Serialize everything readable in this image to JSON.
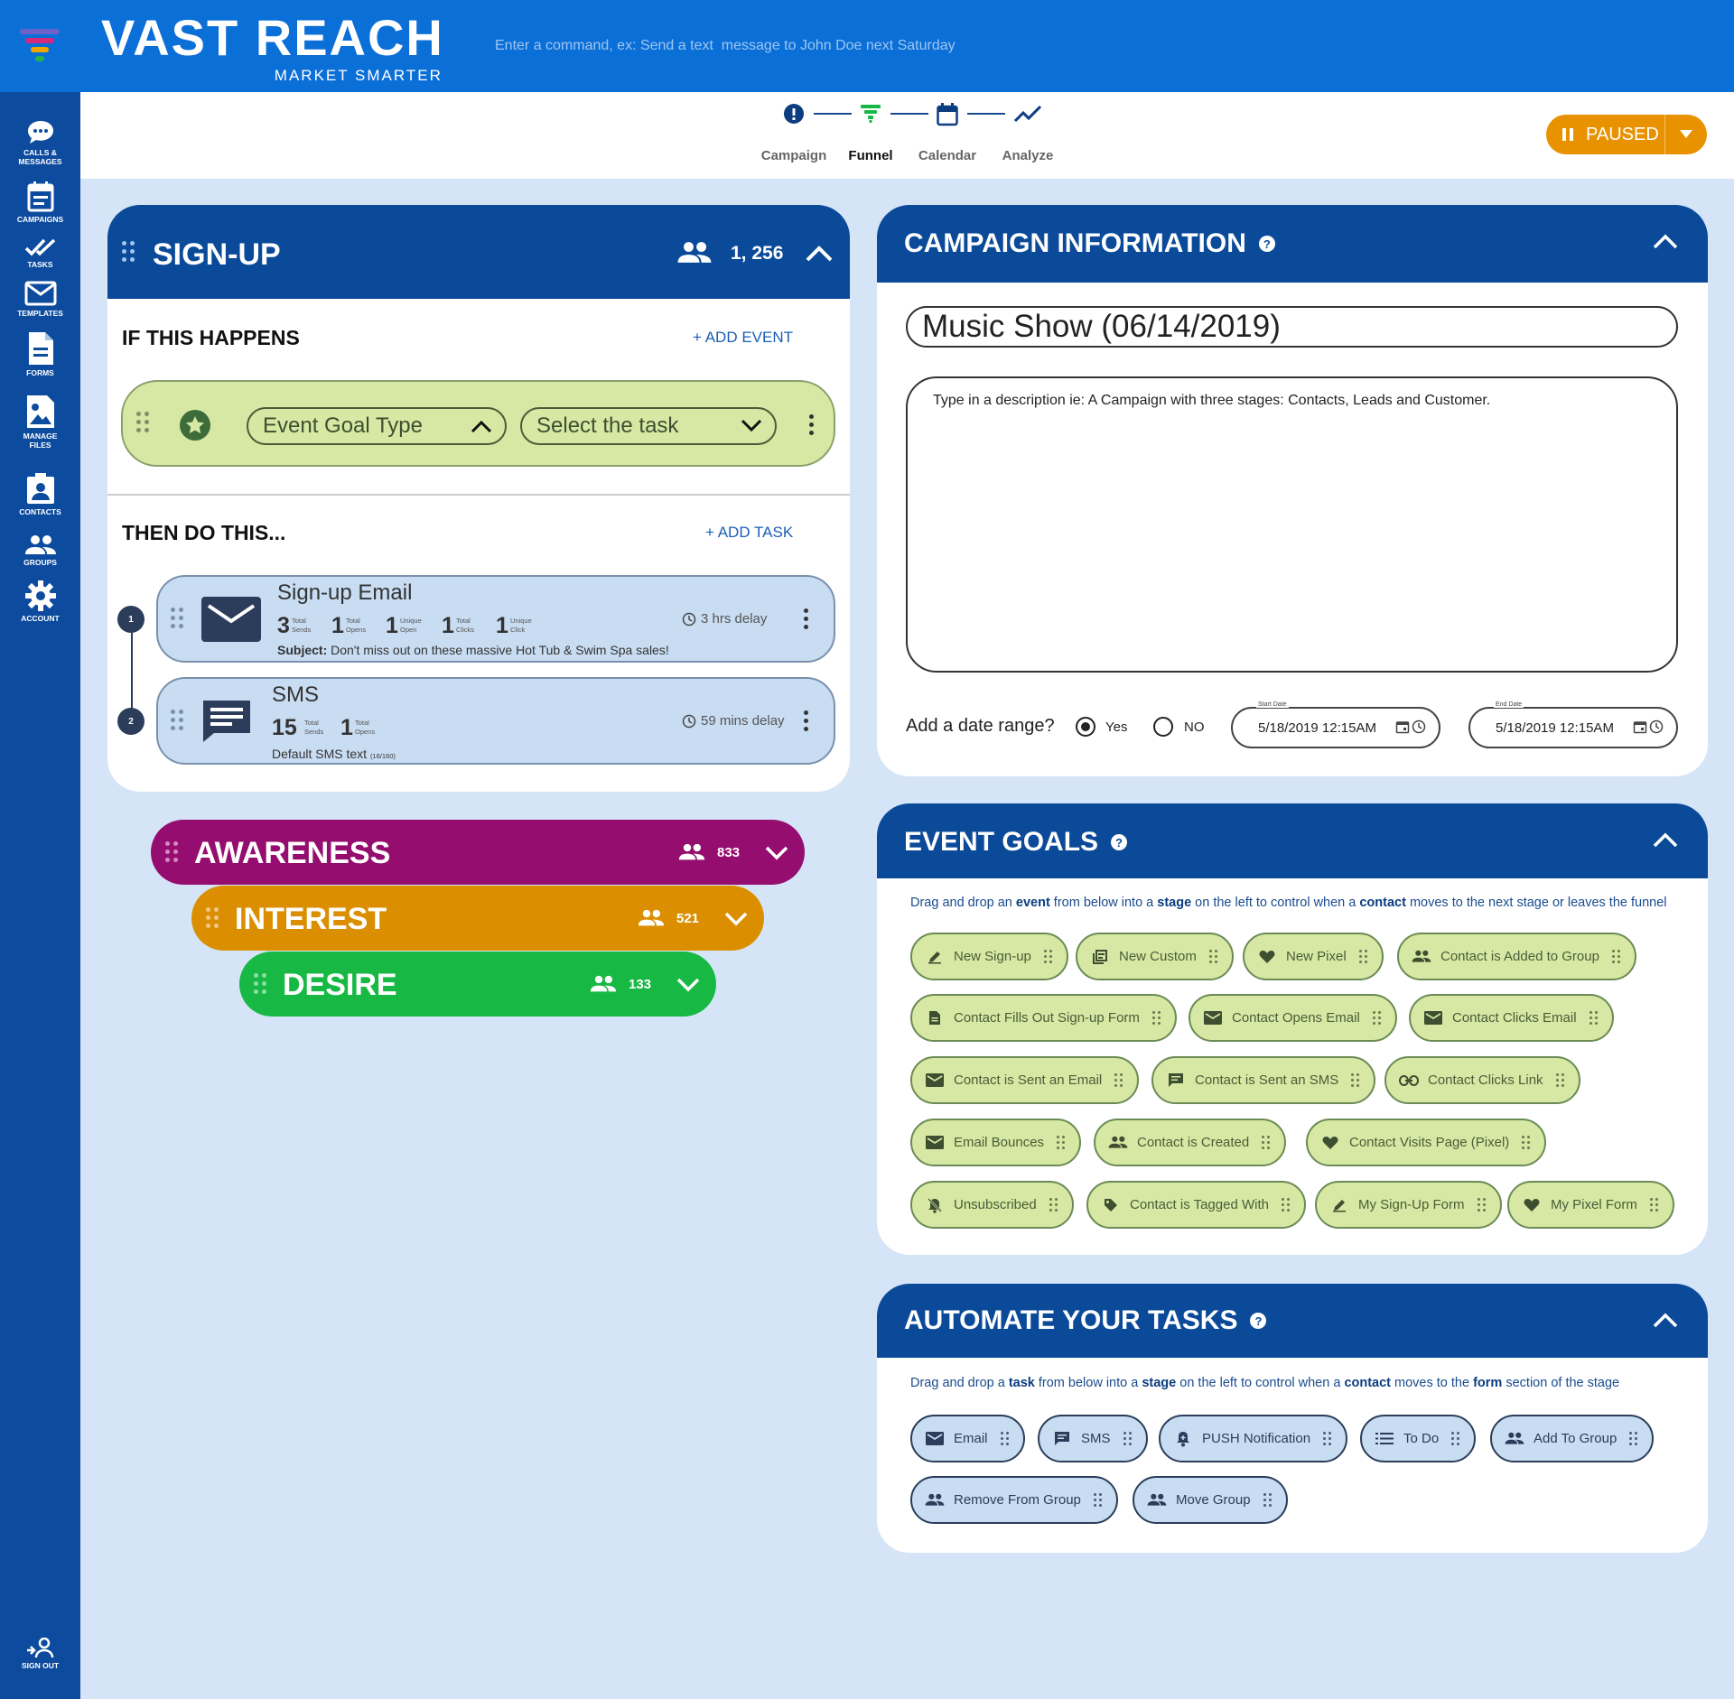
{
  "brand": {
    "name": "VAST REACH",
    "tagline": "MARKET SMARTER"
  },
  "command": {
    "placeholder": "Enter a command, ex: Send a text  message to John Doe next Saturday"
  },
  "sidebar": {
    "items": [
      {
        "label": "CALLS &\nMESSAGES",
        "icon": "chat-icon"
      },
      {
        "label": "CAMPAIGNS",
        "icon": "calendar-list-icon"
      },
      {
        "label": "TASKS",
        "icon": "double-check-icon"
      },
      {
        "label": "TEMPLATES",
        "icon": "envelope-icon"
      },
      {
        "label": "FORMS",
        "icon": "document-icon"
      },
      {
        "label": "MANAGE\nFILES",
        "icon": "image-file-icon"
      },
      {
        "label": "CONTACTS",
        "icon": "contact-card-icon"
      },
      {
        "label": "GROUPS",
        "icon": "group-icon"
      },
      {
        "label": "ACCOUNT",
        "icon": "gear-icon"
      }
    ],
    "signout": "SIGN OUT"
  },
  "steps": [
    {
      "label": "Campaign",
      "icon": "alert-icon"
    },
    {
      "label": "Funnel",
      "icon": "funnel-icon",
      "active": true
    },
    {
      "label": "Calendar",
      "icon": "calendar-icon"
    },
    {
      "label": "Analyze",
      "icon": "trend-icon"
    }
  ],
  "status": {
    "label": "PAUSED",
    "color": "#e89200"
  },
  "signup": {
    "title": "SIGN-UP",
    "count": "1, 256",
    "if_title": "IF THIS HAPPENS",
    "add_event": "+ ADD EVENT",
    "event_goal_type": "Event Goal Type",
    "select_task": "Select the task",
    "then_title": "THEN DO THIS...",
    "add_task": "+ ADD TASK",
    "tasks": [
      {
        "number": "1",
        "title": "Sign-up Email",
        "stats": [
          {
            "value": "3",
            "label": "Total\nSends"
          },
          {
            "value": "1",
            "label": "Total\nOpens"
          },
          {
            "value": "1",
            "label": "Unique\nOpen"
          },
          {
            "value": "1",
            "label": "Total\nClicks"
          },
          {
            "value": "1",
            "label": "Unique\nClick"
          }
        ],
        "delay": "3 hrs delay",
        "subject_label": "Subject:",
        "subject": "Don't miss out on these massive Hot Tub & Swim Spa sales!"
      },
      {
        "number": "2",
        "title": "SMS",
        "stats": [
          {
            "value": "15",
            "label": "Total\nSends"
          },
          {
            "value": "1",
            "label": "Total\nOpens"
          }
        ],
        "delay": "59 mins delay",
        "sub": "Default SMS text",
        "sub_count": "(16/160)"
      }
    ]
  },
  "stages": [
    {
      "name": "AWARENESS",
      "count": "833",
      "color": "#950e6f"
    },
    {
      "name": "INTEREST",
      "count": "521",
      "color": "#db8f00"
    },
    {
      "name": "DESIRE",
      "count": "133",
      "color": "#17b944"
    }
  ],
  "campaign_info": {
    "title": "CAMPAIGN INFORMATION",
    "name": "Music Show (06/14/2019)",
    "description_placeholder": "Type in a description ie: A Campaign with three stages: Contacts, Leads and Customer.",
    "date_range_label": "Add a date range?",
    "yes": "Yes",
    "no": "NO",
    "start_label": "Start Date",
    "start_value": "5/18/2019 12:15AM",
    "end_label": "End Date",
    "end_value": "5/18/2019 12:15AM"
  },
  "event_goals": {
    "title": "EVENT GOALS",
    "hint": {
      "p1": "Drag and drop an ",
      "b1": "event",
      "p2": " from below into a ",
      "b2": "stage",
      "p3": " on the left to control when a ",
      "b3": "contact",
      "p4": " moves to the next stage or leaves the funnel"
    },
    "chips": [
      {
        "label": "New Sign-up",
        "icon": "pencil-icon"
      },
      {
        "label": "New Custom",
        "icon": "custom-icon"
      },
      {
        "label": "New Pixel",
        "icon": "heart-icon"
      },
      {
        "label": "Contact is Added to Group",
        "icon": "group-icon"
      },
      {
        "label": "Contact Fills Out Sign-up Form",
        "icon": "document-icon"
      },
      {
        "label": "Contact Opens Email",
        "icon": "envelope-icon"
      },
      {
        "label": "Contact Clicks Email",
        "icon": "envelope-icon"
      },
      {
        "label": "Contact is Sent an Email",
        "icon": "envelope-icon"
      },
      {
        "label": "Contact is Sent an SMS",
        "icon": "message-icon"
      },
      {
        "label": "Contact Clicks Link",
        "icon": "link-icon"
      },
      {
        "label": "Email Bounces",
        "icon": "envelope-icon"
      },
      {
        "label": "Contact is Created",
        "icon": "group-icon"
      },
      {
        "label": "Contact Visits Page (Pixel)",
        "icon": "heart-icon"
      },
      {
        "label": "Unsubscribed",
        "icon": "bell-off-icon"
      },
      {
        "label": "Contact is Tagged With",
        "icon": "tag-icon"
      },
      {
        "label": "My Sign-Up Form",
        "icon": "pencil-icon"
      },
      {
        "label": "My Pixel Form",
        "icon": "heart-icon"
      }
    ]
  },
  "automate": {
    "title": "AUTOMATE YOUR TASKS",
    "hint": {
      "p1": "Drag and drop a ",
      "b1": "task",
      "p2": " from below into a ",
      "b2": "stage",
      "p3": " on the left to control when a ",
      "b3": "contact",
      "p4": " moves to the ",
      "b4": "form",
      "p5": " section of the stage"
    },
    "chips": [
      {
        "label": "Email",
        "icon": "envelope-icon"
      },
      {
        "label": "SMS",
        "icon": "message-icon"
      },
      {
        "label": "PUSH Notification",
        "icon": "bell-icon"
      },
      {
        "label": "To Do",
        "icon": "list-icon"
      },
      {
        "label": "Add To Group",
        "icon": "group-icon"
      },
      {
        "label": "Remove From Group",
        "icon": "group-icon"
      },
      {
        "label": "Move Group",
        "icon": "group-icon"
      }
    ]
  }
}
